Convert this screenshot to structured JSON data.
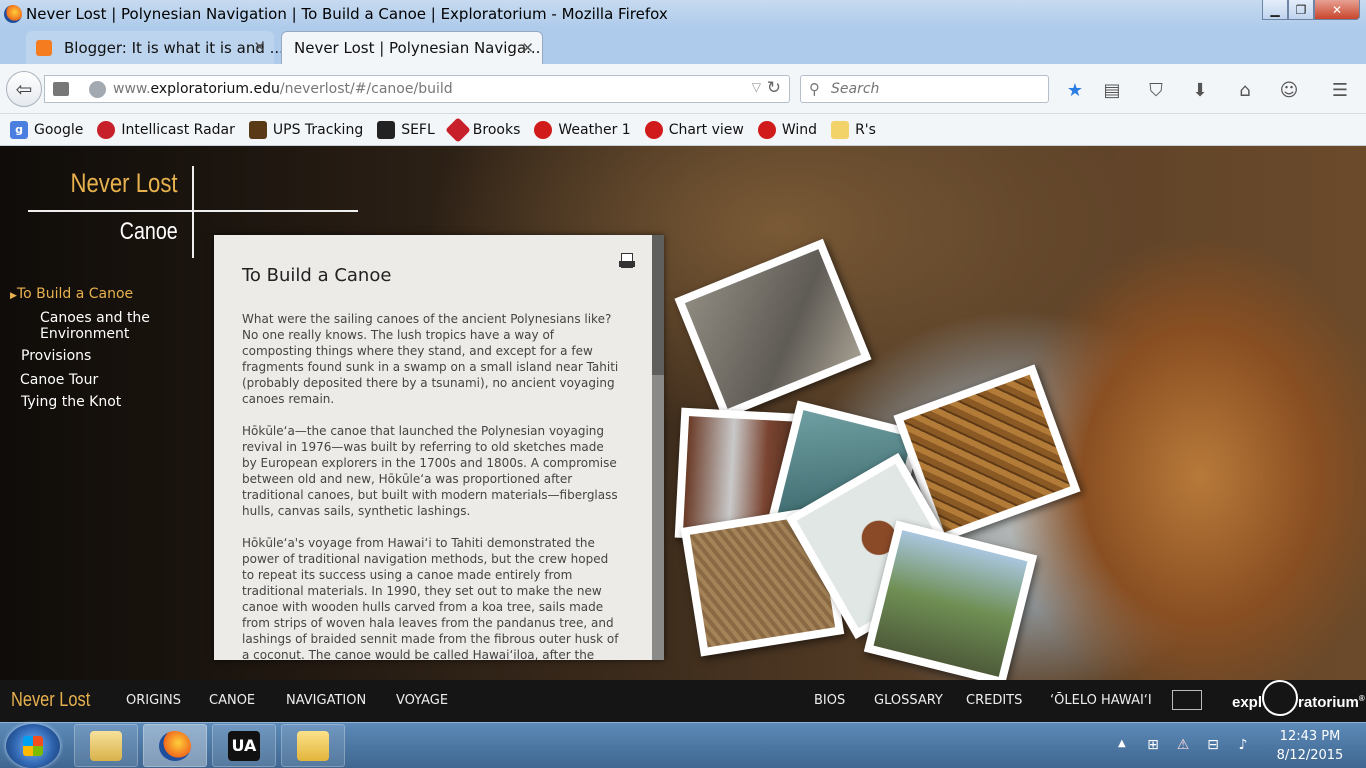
{
  "window": {
    "title": "Never Lost | Polynesian Navigation | To Build a Canoe | Exploratorium - Mozilla Firefox",
    "minimize": "▁",
    "maximize": "❐",
    "close": "✕"
  },
  "tabs": [
    {
      "label": "Blogger: It is what it is and ...",
      "active": false
    },
    {
      "label": "Never Lost | Polynesian Naviga...",
      "active": true
    }
  ],
  "newtab_label": "+",
  "urlbar": {
    "prefix": "www.",
    "domain": "exploratorium.edu",
    "path": "/neverlost/#/canoe/build"
  },
  "search": {
    "placeholder": "Search"
  },
  "toolbar_icons": [
    "bookmark-star-icon",
    "reading-list-icon",
    "pocket-icon",
    "download-icon",
    "home-icon",
    "chat-icon",
    "menu-icon"
  ],
  "bookmarks": [
    {
      "label": "Google",
      "icon": "google-icon",
      "color": "#4a7fe0"
    },
    {
      "label": "Intellicast Radar",
      "icon": "intellicast-icon",
      "color": "#c8202a"
    },
    {
      "label": "UPS Tracking",
      "icon": "ups-icon",
      "color": "#5a3a16"
    },
    {
      "label": "SEFL",
      "icon": "sefl-icon",
      "color": "#222222"
    },
    {
      "label": "Brooks",
      "icon": "brooks-icon",
      "color": "#c8202a"
    },
    {
      "label": "Weather 1",
      "icon": "weather-icon",
      "color": "#d11a1a"
    },
    {
      "label": "Chart view",
      "icon": "chart-icon",
      "color": "#d11a1a"
    },
    {
      "label": "Wind",
      "icon": "wind-icon",
      "color": "#d11a1a"
    },
    {
      "label": "R's",
      "icon": "folder-icon",
      "color": "#f2d36a"
    }
  ],
  "site": {
    "brand": "Never Lost",
    "section": "Canoe",
    "accent": "#e7b24e",
    "sidenav": [
      {
        "label": "To Build a Canoe",
        "active": true,
        "sub": false
      },
      {
        "label": "Canoes and the Environment",
        "active": false,
        "sub": true
      },
      {
        "label": "Provisions",
        "active": false,
        "sub": false
      },
      {
        "label": "Canoe Tour",
        "active": false,
        "sub": false
      },
      {
        "label": "Tying the Knot",
        "active": false,
        "sub": false
      }
    ],
    "article": {
      "title": "To Build a Canoe",
      "paragraphs": [
        "What were the sailing canoes of the ancient Polynesians like? No one really knows. The lush tropics have a way of composting things where they stand, and except for a few fragments found sunk in a swamp on a small island near Tahiti (probably deposited there by a tsunami), no ancient voyaging canoes remain.",
        "Hōkūle‘a—the canoe that launched the Polynesian voyaging revival in 1976—was built by referring to old sketches made by European explorers in the 1700s and 1800s. A compromise between old and new, Hōkūle‘a was proportioned after traditional canoes, but built with modern materials—fiberglass hulls, canvas sails, synthetic lashings.",
        "Hōkūle‘a's voyage from Hawai‘i to Tahiti demonstrated the power of traditional navigation methods, but the crew hoped to repeat its success using a canoe made entirely from traditional materials. In 1990, they set out to make the new canoe with wooden hulls carved from a koa tree, sails made from strips of woven hala leaves from the pandanus tree, and lashings of braided sennit made from the fibrous outer husk of a coconut. The canoe would be called Hawai‘iloa, after the voyager said to"
      ]
    },
    "bottomnav": {
      "brand": "Never Lost",
      "left": [
        "ORIGINS",
        "CANOE",
        "NAVIGATION",
        "VOYAGE"
      ],
      "right": [
        "BIOS",
        "GLOSSARY",
        "CREDITS",
        "‘ŌLELO HAWAI‘I"
      ],
      "logo_left": "expl",
      "logo_right": "ratorium",
      "logo_mark": "®"
    }
  },
  "taskbar": {
    "apps": [
      "explorer-icon",
      "firefox-icon",
      "ua-app-icon",
      "outlook-icon"
    ],
    "ua_label": "UA",
    "time": "12:43 PM",
    "date": "8/12/2015"
  }
}
